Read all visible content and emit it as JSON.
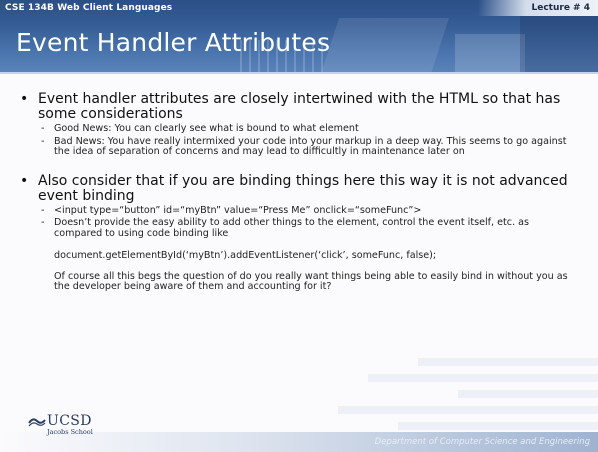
{
  "header": {
    "course": "CSE 134B  Web Client Languages",
    "lecture": "Lecture # 4",
    "title": "Event Handler Attributes"
  },
  "bullets": [
    {
      "text": "Event handler attributes are closely intertwined with the HTML so that has some considerations",
      "subs": [
        "Good News: You can clearly see what is bound to what element",
        "Bad News: You have really intermixed your code into your markup in a deep way.  This seems to go against the idea of separation of concerns and may lead to difficultly in maintenance later on"
      ]
    },
    {
      "text": "Also consider that if you are binding things here this way it is not advanced event binding",
      "subs": [
        "<input type=“button” id=“myBtn” value=“Press Me” onclick=“someFunc”>",
        "Doesn’t provide the easy ability to add other things to the element, control the event itself, etc. as compared to using code binding like"
      ],
      "code_line": "document.getElementById(‘myBtn’).addEventListener(‘click’, someFunc, false);",
      "closing": "Of course all this begs the question of do you really want things being able to easily bind in without you as the developer being aware of them and accounting for it?"
    }
  ],
  "footer": {
    "logo_name": "UCSD",
    "logo_sub": "Jacobs School",
    "department": "Department of Computer Science and Engineering"
  },
  "colors": {
    "header_blue": "#365d96",
    "text": "#111111",
    "logo": "#253a63"
  },
  "icons": {
    "bullet": "•",
    "dash": "-",
    "logo_mark": "ucsd-wave-icon"
  }
}
